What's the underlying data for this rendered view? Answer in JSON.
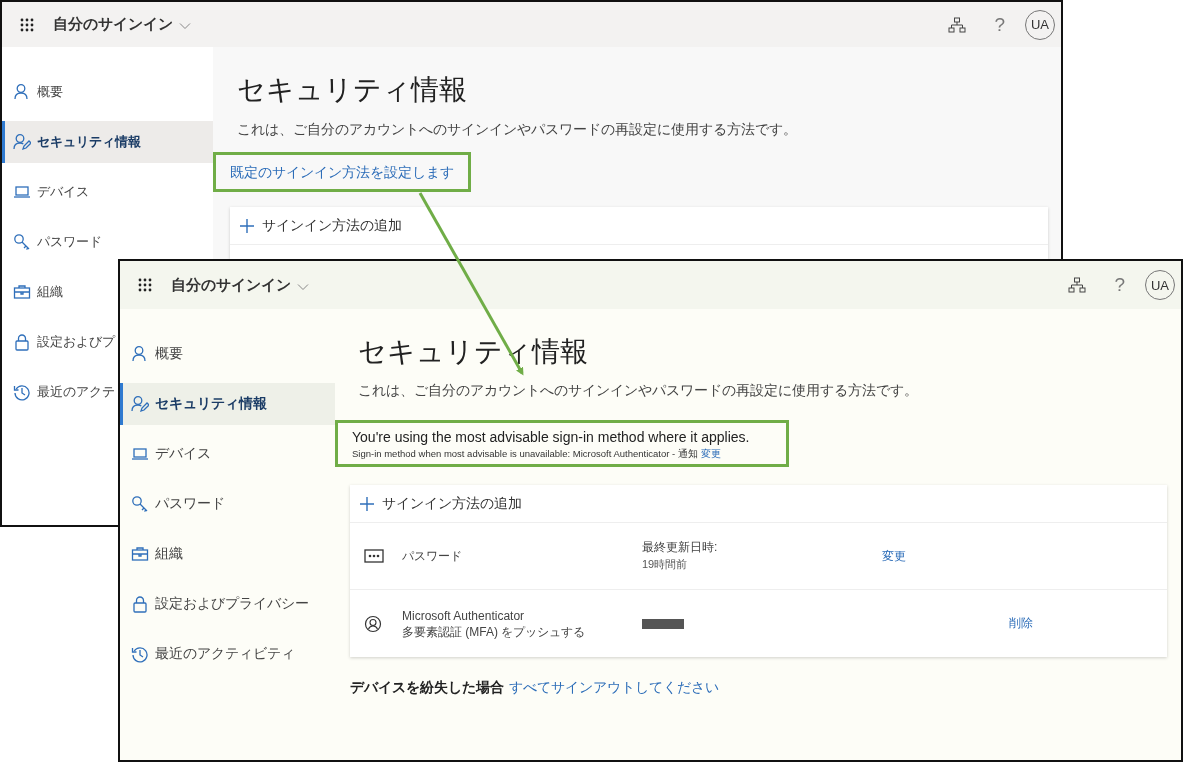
{
  "windows": [
    {
      "header": {
        "app_title": "自分のサインイン",
        "help": "?",
        "avatar": "UA"
      },
      "sidebar": {
        "items": [
          {
            "kind": "person",
            "label": "概要",
            "selected": false
          },
          {
            "kind": "security",
            "label": "セキュリティ情報",
            "selected": true
          },
          {
            "kind": "laptop",
            "label": "デバイス",
            "selected": false
          },
          {
            "kind": "key",
            "label": "パスワード",
            "selected": false
          },
          {
            "kind": "briefcase",
            "label": "組織",
            "selected": false
          },
          {
            "kind": "lock",
            "label": "設定およびプ",
            "selected": false
          },
          {
            "kind": "history",
            "label": "最近のアクテ",
            "selected": false
          }
        ]
      },
      "main": {
        "title": "セキュリティ情報",
        "description": "これは、ご自分のアカウントへのサインインやパスワードの再設定に使用する方法です。",
        "default_link": {
          "label": "既定のサインイン方法を設定します",
          "highlighted": true
        },
        "card": {
          "add_label": "サインイン方法の追加"
        }
      }
    },
    {
      "header": {
        "app_title": "自分のサインイン",
        "help": "?",
        "avatar": "UA"
      },
      "sidebar": {
        "items": [
          {
            "kind": "person",
            "label": "概要",
            "selected": false
          },
          {
            "kind": "security",
            "label": "セキュリティ情報",
            "selected": true
          },
          {
            "kind": "laptop",
            "label": "デバイス",
            "selected": false
          },
          {
            "kind": "key",
            "label": "パスワード",
            "selected": false
          },
          {
            "kind": "briefcase",
            "label": "組織",
            "selected": false
          },
          {
            "kind": "lock",
            "label": "設定およびプライバシー",
            "selected": false
          },
          {
            "kind": "history",
            "label": "最近のアクティビティ",
            "selected": false
          }
        ]
      },
      "main": {
        "title": "セキュリティ情報",
        "description": "これは、ご自分のアカウントへのサインインやパスワードの再設定に使用する方法です。",
        "notice": {
          "headline": "You're using the most advisable sign-in method where it applies.",
          "detail": "Sign-in method when most advisable is unavailable: Microsoft Authenticator - 通知",
          "link": "変更",
          "highlighted": true
        },
        "card": {
          "add_label": "サインイン方法の追加",
          "methods": [
            {
              "kind": "password",
              "name": "パスワード",
              "detail_label": "最終更新日時:",
              "detail_value": "19時間前",
              "action": "変更"
            },
            {
              "kind": "authenticator",
              "name": "Microsoft Authenticator",
              "subtitle": "多要素認証 (MFA) をプッシュする",
              "redacted": true,
              "action": "削除"
            }
          ]
        },
        "lost_device": {
          "label": "デバイスを紛失した場合",
          "link": "すべてサインアウトしてください"
        }
      }
    }
  ]
}
